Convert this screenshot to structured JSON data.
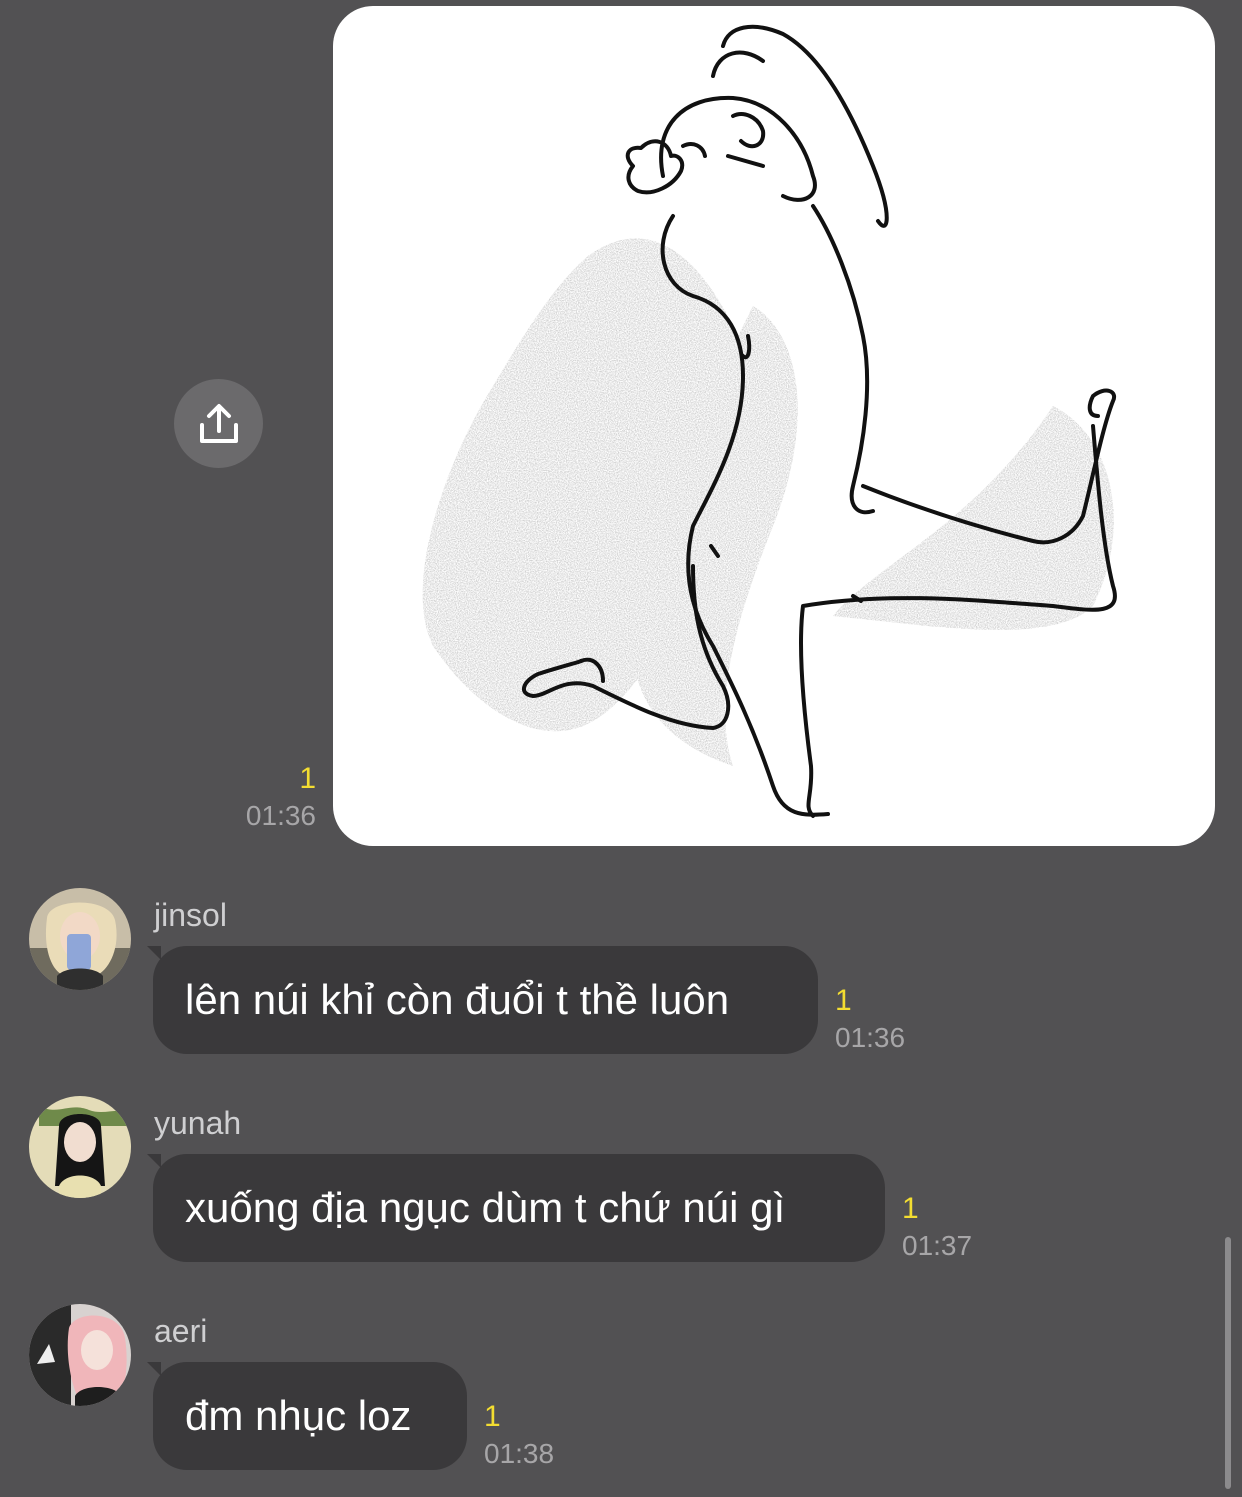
{
  "image_message": {
    "unread_count": "1",
    "time": "01:36",
    "share_icon": "share-upload-icon",
    "image": "hand-drawn sketch"
  },
  "messages": [
    {
      "sender": "jinsol",
      "text": "lên núi khỉ còn đuổi t thề luôn",
      "unread_count": "1",
      "time": "01:36",
      "avatar": "avatar-jinsol"
    },
    {
      "sender": "yunah",
      "text": "xuống địa ngục dùm t chứ núi gì",
      "unread_count": "1",
      "time": "01:37",
      "avatar": "avatar-yunah"
    },
    {
      "sender": "aeri",
      "text": "đm nhục loz",
      "unread_count": "1",
      "time": "01:38",
      "avatar": "avatar-aeri"
    }
  ],
  "colors": {
    "background": "#525153",
    "bubble": "#3a393b",
    "unread": "#f3dd31",
    "time": "#a7a6a8"
  }
}
